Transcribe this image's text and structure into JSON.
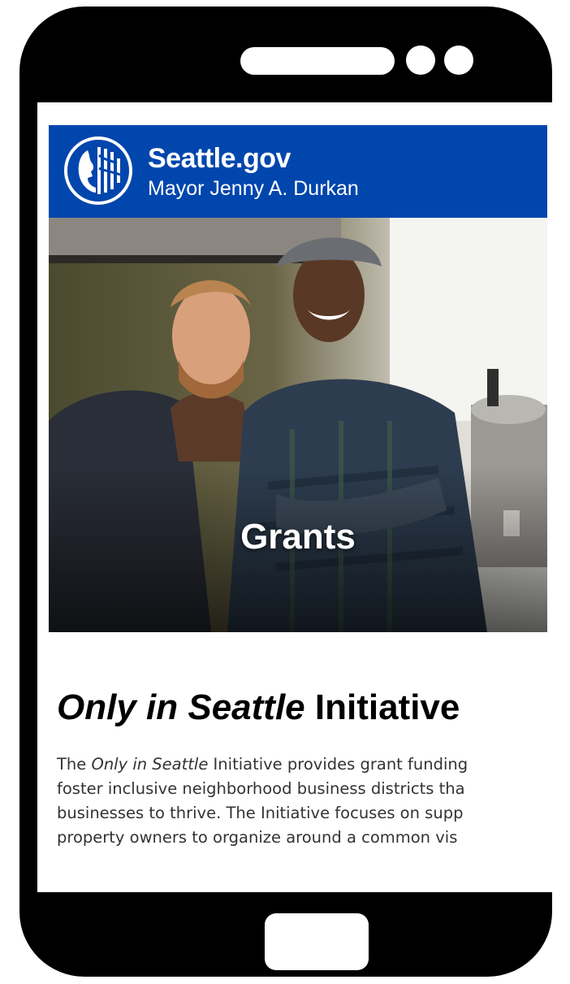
{
  "header": {
    "site_name": "Seattle.gov",
    "subtitle": "Mayor Jenny A. Durkan"
  },
  "hero": {
    "label": "Grants"
  },
  "article": {
    "heading_italic": "Only in Seattle",
    "heading_rest": " Initiative",
    "line1_prefix": "The ",
    "line1_italic": "Only in Seattle",
    "line1_rest": " Initiative provides grant funding",
    "line2": "foster inclusive neighborhood business districts tha",
    "line3": "businesses to thrive. The Initiative focuses on supp",
    "line4": "property owners to organize around a common vis"
  },
  "colors": {
    "header_blue": "#0046ad",
    "phone_frame": "#000000"
  }
}
